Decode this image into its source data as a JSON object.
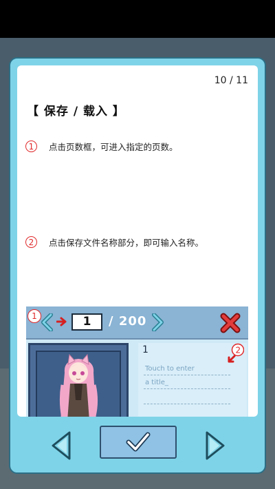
{
  "page_counter": "10 / 11",
  "section_title": "【 保存 / 载入 】",
  "steps": [
    {
      "num": "1",
      "text": "点击页数框，可进入指定的页数。"
    },
    {
      "num": "2",
      "text": "点击保存文件名称部分，即可输入名称。"
    }
  ],
  "preview": {
    "badge_1": "1",
    "badge_2": "2",
    "current_page": "1",
    "total_pages": "/ 200",
    "slot_number": "1",
    "title_hint_line1": "Touch to enter",
    "title_hint_line2": "a title_"
  },
  "colors": {
    "dialog_border": "#7fd3e8",
    "accent_red": "#e0282a",
    "header_blue": "#8ab3d4",
    "arrow_teal": "#3fa9bd"
  },
  "icons": {
    "prev": "chevron-left-icon",
    "next": "chevron-right-icon",
    "close": "close-x-icon",
    "confirm": "check-icon"
  }
}
